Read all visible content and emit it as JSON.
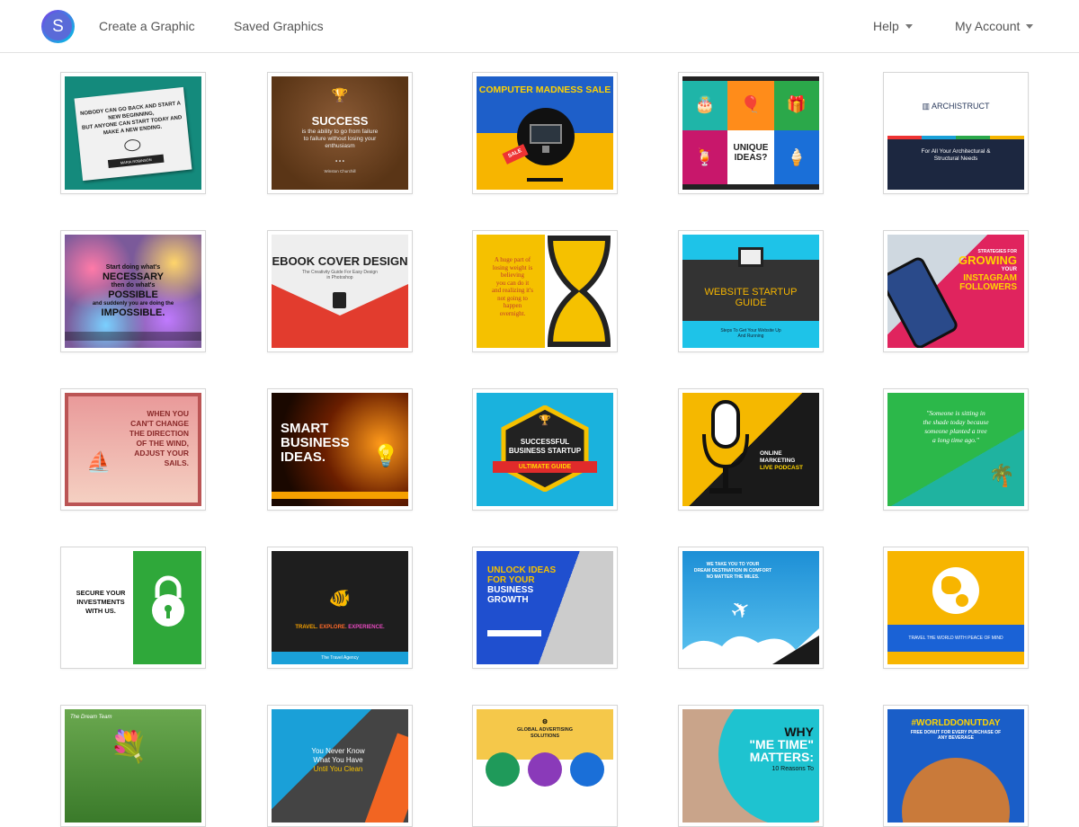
{
  "nav": {
    "logo_letter": "S",
    "links": [
      "Create a Graphic",
      "Saved Graphics"
    ],
    "help": "Help",
    "account": "My Account"
  },
  "templates": [
    {
      "lines": [
        "NOBODY CAN GO BACK AND START A",
        "NEW BEGINNING,",
        "BUT ANYONE CAN START TODAY AND",
        "MAKE A NEW ENDING."
      ],
      "sub": "MARIA ROBINSON"
    },
    {
      "lines": [
        "SUCCESS",
        "is the ability to go from failure",
        "to failure without losing your",
        "enthusiasm"
      ],
      "sub": "Winston Churchill"
    },
    {
      "lines": [
        "COMPUTER MADNESS SALE",
        "SALE"
      ]
    },
    {
      "lines": [
        "UNIQUE",
        "IDEAS?"
      ]
    },
    {
      "lines": [
        "ARCHISTRUCT",
        "For All Your Architectural &",
        "Structural Needs"
      ]
    },
    {
      "lines": [
        "Start doing what's",
        "NECESSARY",
        "then do what's",
        "POSSIBLE",
        "and suddenly you are doing the",
        "IMPOSSIBLE."
      ]
    },
    {
      "lines": [
        "EBOOK COVER DESIGN",
        "The Creativity Guide For Easy Design",
        "in Photoshop"
      ]
    },
    {
      "lines": [
        "A huge part of",
        "losing weight is",
        "believing",
        "you can do it",
        "and realizing it's",
        "not going to",
        "happen",
        "overnight."
      ]
    },
    {
      "lines": [
        "WEBSITE STARTUP",
        "GUIDE",
        "Steps To Get Your Website Up",
        "And Running"
      ]
    },
    {
      "lines": [
        "STRATEGIES FOR",
        "GROWING",
        "YOUR",
        "INSTAGRAM",
        "FOLLOWERS"
      ]
    },
    {
      "lines": [
        "WHEN YOU",
        "CAN'T CHANGE",
        "THE DIRECTION",
        "OF THE WIND,",
        "ADJUST YOUR",
        "SAILS."
      ]
    },
    {
      "lines": [
        "SMART",
        "BUSINESS",
        "IDEAS."
      ]
    },
    {
      "lines": [
        "SUCCESSFUL",
        "BUSINESS STARTUP",
        "ULTIMATE GUIDE"
      ]
    },
    {
      "lines": [
        "ONLINE",
        "MARKETING",
        "LIVE PODCAST"
      ]
    },
    {
      "lines": [
        "\"Someone is sitting in",
        "the shade today because",
        "someone planted a tree",
        "a long time ago.\""
      ]
    },
    {
      "lines": [
        "SECURE YOUR",
        "INVESTMENTS",
        "WITH US."
      ]
    },
    {
      "lines": [
        "TRAVEL.",
        "EXPLORE.",
        "EXPERIENCE.",
        "The Travel Agency"
      ]
    },
    {
      "lines": [
        "UNLOCK IDEAS",
        "FOR YOUR",
        "BUSINESS",
        "GROWTH"
      ]
    },
    {
      "lines": [
        "WE TAKE YOU TO YOUR",
        "DREAM DESTINATION IN COMFORT",
        "NO MATTER THE MILES."
      ]
    },
    {
      "lines": [
        "TRAVEL THE WORLD WITH PEACE OF MIND"
      ]
    },
    {
      "lines": [
        "The Dream Team"
      ]
    },
    {
      "lines": [
        "You Never Know",
        "What You Have",
        "Until You Clean"
      ]
    },
    {
      "lines": [
        "GLOBAL ADVERTISING",
        "SOLUTIONS"
      ]
    },
    {
      "lines": [
        "WHY",
        "\"ME TIME\"",
        "MATTERS:",
        "10 Reasons To"
      ]
    },
    {
      "lines": [
        "#WORLDDONUTDAY",
        "FREE DONUT FOR EVERY PURCHASE OF",
        "ANY BEVERAGE"
      ]
    }
  ],
  "colors": {
    "accent": "#00c3e3",
    "nav_text": "#555555"
  }
}
